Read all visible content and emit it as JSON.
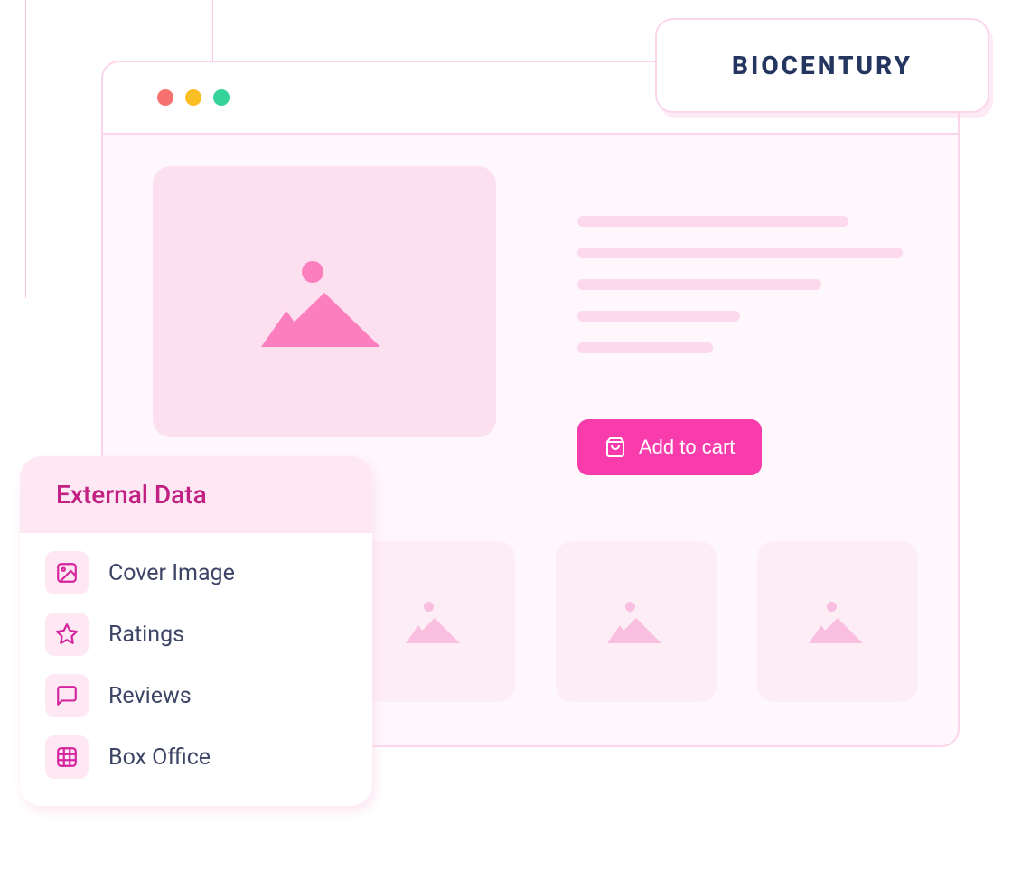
{
  "badge": {
    "text": "BIOCENTURY"
  },
  "main": {
    "add_to_cart_label": "Add to cart"
  },
  "external_data_panel": {
    "title": "External Data",
    "items": [
      {
        "label": "Cover Image",
        "icon": "image-icon"
      },
      {
        "label": "Ratings",
        "icon": "star-icon"
      },
      {
        "label": "Reviews",
        "icon": "message-icon"
      },
      {
        "label": "Box Office",
        "icon": "grid-icon"
      }
    ]
  }
}
